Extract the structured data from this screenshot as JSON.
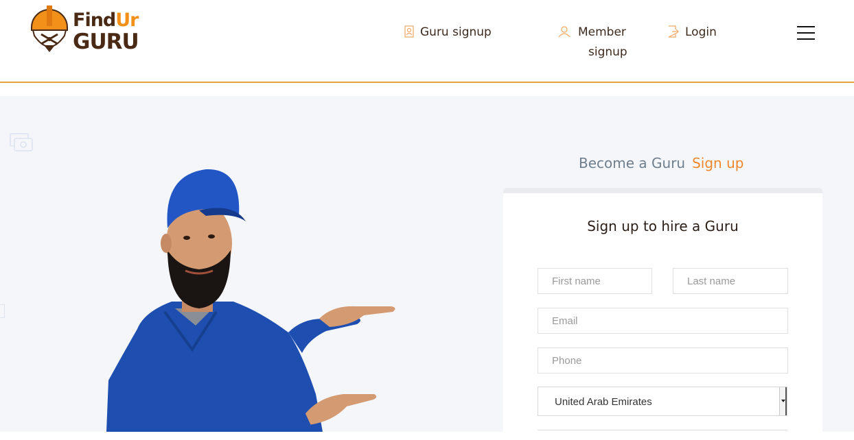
{
  "brand": {
    "find": "Find",
    "ur": "Ur",
    "guru": "GURU"
  },
  "nav": {
    "guru_signup": "Guru signup",
    "member_line1": "Member",
    "member_line2": "signup",
    "login": "Login"
  },
  "hero": {
    "become": "Become a Guru",
    "signup": "Sign up"
  },
  "form": {
    "title": "Sign up to hire a Guru",
    "first_name_placeholder": "First name",
    "last_name_placeholder": "Last name",
    "email_placeholder": "Email",
    "phone_placeholder": "Phone",
    "country": "United Arab Emirates"
  },
  "colors": {
    "accent": "#f0872b",
    "header_border": "#e8a33b",
    "brand_brown": "#4a2a14",
    "overall_blue": "#1e4fb0"
  },
  "icons": [
    "hardhat-logo-icon",
    "id-badge-icon",
    "user-icon",
    "login-icon",
    "hamburger-menu-icon"
  ]
}
